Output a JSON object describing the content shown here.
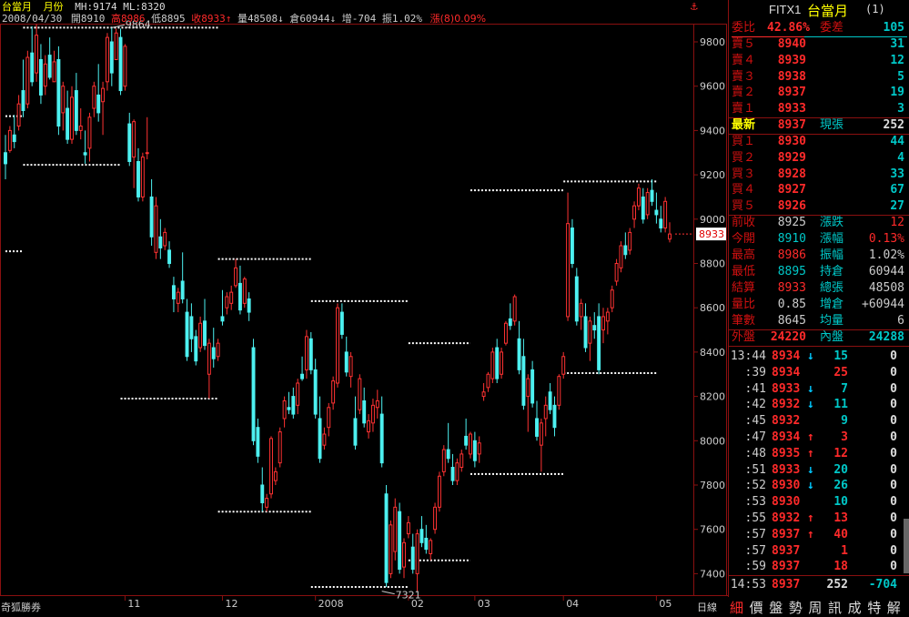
{
  "header": {
    "name": "台當月",
    "period": "月份",
    "ma": "MH:9174 ML:8320",
    "date": "2008/04/30",
    "open_lbl": "開",
    "open": "8910",
    "high_lbl": "高",
    "high": "8986",
    "low_lbl": "低",
    "low": "8895",
    "close_lbl": "收",
    "close": "8933",
    "vol_lbl": "量",
    "vol": "48508",
    "oi_lbl": "倉",
    "oi": "60944",
    "inc_lbl": "增",
    "inc": "-704",
    "amp_lbl": "振",
    "amp": "1.02%",
    "chg": "漲(8)0.09%"
  },
  "bottom": {
    "broker": "奇狐勝券",
    "line_mode": "日線"
  },
  "panel": {
    "symbol": "FITX1",
    "name": "台當月",
    "index": "(1)",
    "ratio_lbl": "委比",
    "ratio": "42.86%",
    "diff_lbl": "委差",
    "diff": "105",
    "asks": [
      {
        "label": "賣５",
        "price": "8940",
        "qty": "31"
      },
      {
        "label": "賣４",
        "price": "8939",
        "qty": "12"
      },
      {
        "label": "賣３",
        "price": "8938",
        "qty": "5"
      },
      {
        "label": "賣２",
        "price": "8937",
        "qty": "19"
      },
      {
        "label": "賣１",
        "price": "8933",
        "qty": "3"
      }
    ],
    "last_lbl": "最新",
    "last": "8937",
    "now_lbl": "現張",
    "now": "252",
    "bids": [
      {
        "label": "買１",
        "price": "8930",
        "qty": "44"
      },
      {
        "label": "買２",
        "price": "8929",
        "qty": "4"
      },
      {
        "label": "買３",
        "price": "8928",
        "qty": "33"
      },
      {
        "label": "買４",
        "price": "8927",
        "qty": "67"
      },
      {
        "label": "買５",
        "price": "8926",
        "qty": "27"
      }
    ],
    "stats": [
      {
        "l1": "前收",
        "v1": "8925",
        "l2": "漲跌",
        "v2": "12",
        "c1": "#cccccc",
        "c2": "#ff2a2a"
      },
      {
        "l1": "今開",
        "v1": "8910",
        "l2": "漲幅",
        "v2": "0.13%",
        "c1": "#00c8c8",
        "c2": "#ff2a2a"
      },
      {
        "l1": "最高",
        "v1": "8986",
        "l2": "振幅",
        "v2": "1.02%",
        "c1": "#ff2a2a",
        "c2": "#cccccc"
      },
      {
        "l1": "最低",
        "v1": "8895",
        "l2": "持倉",
        "v2": "60944",
        "c1": "#00c8c8",
        "c2": "#cccccc"
      },
      {
        "l1": "結算",
        "v1": "8933",
        "l2": "總張",
        "v2": "48508",
        "c1": "#ff2a2a",
        "c2": "#cccccc"
      },
      {
        "l1": "量比",
        "v1": "0.85",
        "l2": "增倉",
        "v2": "+60944",
        "c1": "#cccccc",
        "c2": "#cccccc"
      },
      {
        "l1": "筆數",
        "v1": "8645",
        "l2": "均量",
        "v2": "6",
        "c1": "#cccccc",
        "c2": "#cccccc"
      }
    ],
    "outer_lbl": "外盤",
    "outer": "24220",
    "inner_lbl": "內盤",
    "inner": "24288",
    "ticks": [
      {
        "t": "13:44",
        "p": "8934",
        "a": "↓",
        "v": "15",
        "c": "0",
        "vc": "cy"
      },
      {
        "t": ":39",
        "p": "8934",
        "a": "",
        "v": "25",
        "c": "0",
        "vc": "rd"
      },
      {
        "t": ":41",
        "p": "8933",
        "a": "↓",
        "v": "7",
        "c": "0",
        "vc": "cy"
      },
      {
        "t": ":42",
        "p": "8932",
        "a": "↓",
        "v": "11",
        "c": "0",
        "vc": "cy"
      },
      {
        "t": ":45",
        "p": "8932",
        "a": "",
        "v": "9",
        "c": "0",
        "vc": "cy"
      },
      {
        "t": ":47",
        "p": "8934",
        "a": "↑",
        "v": "3",
        "c": "0",
        "vc": "rd"
      },
      {
        "t": ":48",
        "p": "8935",
        "a": "↑",
        "v": "12",
        "c": "0",
        "vc": "rd"
      },
      {
        "t": ":51",
        "p": "8933",
        "a": "↓",
        "v": "20",
        "c": "0",
        "vc": "cy"
      },
      {
        "t": ":52",
        "p": "8930",
        "a": "↓",
        "v": "26",
        "c": "0",
        "vc": "cy"
      },
      {
        "t": ":53",
        "p": "8930",
        "a": "",
        "v": "10",
        "c": "0",
        "vc": "cy"
      },
      {
        "t": ":55",
        "p": "8932",
        "a": "↑",
        "v": "13",
        "c": "0",
        "vc": "rd"
      },
      {
        "t": ":57",
        "p": "8937",
        "a": "↑",
        "v": "40",
        "c": "0",
        "vc": "rd"
      },
      {
        "t": ":57",
        "p": "8937",
        "a": "",
        "v": "1",
        "c": "0",
        "vc": "rd"
      },
      {
        "t": ":59",
        "p": "8937",
        "a": "",
        "v": "18",
        "c": "0",
        "vc": "rd"
      }
    ],
    "last_tick": {
      "t": "14:53",
      "p": "8937",
      "v": "252",
      "c": "-704"
    },
    "menu": [
      "細",
      "價",
      "盤",
      "勢",
      "周",
      "訊",
      "成",
      "特",
      "解"
    ]
  },
  "chart_data": {
    "type": "candlestick",
    "ylim": [
      7300,
      9940
    ],
    "y_ticks": [
      7400,
      7600,
      7800,
      8000,
      8200,
      8400,
      8600,
      8800,
      9000,
      9200,
      9400,
      9600,
      9800
    ],
    "x_labels": [
      {
        "label": "11",
        "index": 27
      },
      {
        "label": "12",
        "index": 49
      },
      {
        "label": "2008",
        "index": 70
      },
      {
        "label": "02",
        "index": 91
      },
      {
        "label": "03",
        "index": 106
      },
      {
        "label": "04",
        "index": 126
      },
      {
        "label": "05",
        "index": 147
      }
    ],
    "current_price": 8933,
    "annotations": [
      {
        "text": "9864",
        "index": 24,
        "value": 9864
      },
      {
        "text": "7321",
        "index": 85,
        "value": 7321
      }
    ],
    "levels": [
      {
        "value": 9864,
        "from": 4,
        "to": 48
      },
      {
        "value": 9465,
        "from": 0,
        "to": 4
      },
      {
        "value": 9245,
        "from": 4,
        "to": 26
      },
      {
        "value": 8855,
        "from": 0,
        "to": 4
      },
      {
        "value": 8820,
        "from": 48,
        "to": 69
      },
      {
        "value": 8630,
        "from": 69,
        "to": 91
      },
      {
        "value": 8440,
        "from": 91,
        "to": 105
      },
      {
        "value": 8190,
        "from": 26,
        "to": 48
      },
      {
        "value": 8305,
        "from": 126,
        "to": 147
      },
      {
        "value": 9130,
        "from": 105,
        "to": 126
      },
      {
        "value": 9170,
        "from": 126,
        "to": 147
      },
      {
        "value": 7850,
        "from": 105,
        "to": 126
      },
      {
        "value": 7680,
        "from": 48,
        "to": 69
      },
      {
        "value": 7460,
        "from": 91,
        "to": 105
      },
      {
        "value": 7340,
        "from": 69,
        "to": 91
      }
    ],
    "candles": [
      [
        9300,
        9380,
        9180,
        9250
      ],
      [
        9310,
        9420,
        9300,
        9400
      ],
      [
        9380,
        9470,
        9320,
        9350
      ],
      [
        9420,
        9560,
        9400,
        9520
      ],
      [
        9580,
        9720,
        9460,
        9490
      ],
      [
        9520,
        9760,
        9500,
        9730
      ],
      [
        9750,
        9870,
        9600,
        9620
      ],
      [
        9660,
        9880,
        9620,
        9830
      ],
      [
        9720,
        9790,
        9520,
        9560
      ],
      [
        9600,
        9740,
        9560,
        9700
      ],
      [
        9740,
        9820,
        9630,
        9640
      ],
      [
        9620,
        9760,
        9620,
        9710
      ],
      [
        9720,
        9780,
        9380,
        9420
      ],
      [
        9480,
        9620,
        9400,
        9600
      ],
      [
        9500,
        9580,
        9340,
        9360
      ],
      [
        9360,
        9600,
        9340,
        9550
      ],
      [
        9580,
        9660,
        9380,
        9400
      ],
      [
        9400,
        9500,
        9360,
        9420
      ],
      [
        9300,
        9400,
        9250,
        9290
      ],
      [
        9320,
        9480,
        9260,
        9460
      ],
      [
        9500,
        9620,
        9460,
        9600
      ],
      [
        9560,
        9700,
        9440,
        9480
      ],
      [
        9530,
        9620,
        9380,
        9590
      ],
      [
        9620,
        9840,
        9580,
        9820
      ],
      [
        9800,
        9864,
        9600,
        9660
      ],
      [
        9720,
        9860,
        9760,
        9840
      ],
      [
        9820,
        9860,
        9560,
        9580
      ],
      [
        9600,
        9790,
        9580,
        9780
      ],
      [
        9430,
        9480,
        9240,
        9260
      ],
      [
        9280,
        9450,
        9140,
        9440
      ],
      [
        9260,
        9320,
        9080,
        9100
      ],
      [
        9100,
        9300,
        9080,
        9280
      ],
      [
        9300,
        9460,
        9270,
        9300
      ],
      [
        9100,
        9180,
        8880,
        8920
      ],
      [
        8850,
        9100,
        8820,
        9060
      ],
      [
        8920,
        9000,
        8820,
        8870
      ],
      [
        8880,
        8960,
        8860,
        8940
      ],
      [
        8860,
        8900,
        8780,
        8800
      ],
      [
        8700,
        8740,
        8580,
        8640
      ],
      [
        8620,
        8690,
        8580,
        8670
      ],
      [
        8720,
        8850,
        8620,
        8640
      ],
      [
        8580,
        8640,
        8360,
        8380
      ],
      [
        8560,
        8620,
        8400,
        8460
      ],
      [
        8470,
        8500,
        8340,
        8360
      ],
      [
        8420,
        8560,
        8400,
        8530
      ],
      [
        8540,
        8640,
        8410,
        8430
      ],
      [
        8300,
        8460,
        8190,
        8440
      ],
      [
        8420,
        8510,
        8330,
        8370
      ],
      [
        8380,
        8460,
        8360,
        8440
      ],
      [
        8560,
        8680,
        8520,
        8540
      ],
      [
        8600,
        8670,
        8570,
        8650
      ],
      [
        8620,
        8700,
        8590,
        8670
      ],
      [
        8700,
        8820,
        8690,
        8780
      ],
      [
        8710,
        8790,
        8570,
        8590
      ],
      [
        8620,
        8740,
        8600,
        8730
      ],
      [
        8640,
        8670,
        8540,
        8580
      ],
      [
        8420,
        8460,
        7980,
        8000
      ],
      [
        8060,
        8100,
        7900,
        7930
      ],
      [
        7800,
        7880,
        7680,
        7720
      ],
      [
        7700,
        7760,
        7680,
        7740
      ],
      [
        7760,
        8020,
        7740,
        8010
      ],
      [
        7820,
        7880,
        7800,
        7860
      ],
      [
        7900,
        8060,
        7880,
        8040
      ],
      [
        8100,
        8200,
        8060,
        8180
      ],
      [
        8150,
        8220,
        8120,
        8140
      ],
      [
        8200,
        8240,
        8100,
        8120
      ],
      [
        8160,
        8280,
        8120,
        8260
      ],
      [
        8300,
        8380,
        8270,
        8280
      ],
      [
        8320,
        8500,
        8280,
        8470
      ],
      [
        8460,
        8490,
        8300,
        8320
      ],
      [
        8320,
        8370,
        8100,
        8120
      ],
      [
        8100,
        8200,
        7900,
        7920
      ],
      [
        7980,
        8060,
        7960,
        8030
      ],
      [
        8060,
        8170,
        8020,
        8150
      ],
      [
        8170,
        8290,
        8140,
        8270
      ],
      [
        8260,
        8620,
        8240,
        8600
      ],
      [
        8580,
        8620,
        8460,
        8480
      ],
      [
        8400,
        8470,
        8290,
        8310
      ],
      [
        8290,
        8400,
        8240,
        8380
      ],
      [
        8100,
        8200,
        7960,
        7980
      ],
      [
        8140,
        8300,
        8120,
        8280
      ],
      [
        8180,
        8240,
        8060,
        8080
      ],
      [
        8040,
        8120,
        8010,
        8090
      ],
      [
        8080,
        8190,
        8040,
        8160
      ],
      [
        8150,
        8230,
        8100,
        8180
      ],
      [
        8120,
        8200,
        7880,
        7900
      ],
      [
        7760,
        7800,
        7340,
        7360
      ],
      [
        7400,
        7640,
        7380,
        7620
      ],
      [
        7500,
        7740,
        7460,
        7700
      ],
      [
        7680,
        7720,
        7400,
        7420
      ],
      [
        7430,
        7560,
        7380,
        7540
      ],
      [
        7580,
        7660,
        7560,
        7630
      ],
      [
        7520,
        7580,
        7400,
        7420
      ],
      [
        7400,
        7600,
        7321,
        7580
      ],
      [
        7600,
        7660,
        7520,
        7540
      ],
      [
        7560,
        7620,
        7490,
        7510
      ],
      [
        7490,
        7560,
        7460,
        7550
      ],
      [
        7600,
        7720,
        7580,
        7700
      ],
      [
        7700,
        7860,
        7680,
        7840
      ],
      [
        7860,
        7980,
        7840,
        7960
      ],
      [
        7960,
        8080,
        7900,
        7920
      ],
      [
        7880,
        7940,
        7800,
        7820
      ],
      [
        7820,
        7920,
        7800,
        7900
      ],
      [
        7880,
        7960,
        7860,
        7940
      ],
      [
        8020,
        8100,
        7960,
        7980
      ],
      [
        7940,
        8040,
        7920,
        8030
      ],
      [
        8000,
        8040,
        7880,
        7910
      ],
      [
        7940,
        8020,
        7900,
        7990
      ],
      [
        8200,
        8260,
        8180,
        8220
      ],
      [
        8240,
        8310,
        8220,
        8300
      ],
      [
        8280,
        8420,
        8260,
        8400
      ],
      [
        8420,
        8460,
        8260,
        8280
      ],
      [
        8300,
        8420,
        8280,
        8400
      ],
      [
        8440,
        8540,
        8430,
        8530
      ],
      [
        8550,
        8620,
        8500,
        8520
      ],
      [
        8540,
        8660,
        8520,
        8650
      ],
      [
        8460,
        8540,
        8300,
        8320
      ],
      [
        8380,
        8460,
        8140,
        8160
      ],
      [
        8200,
        8300,
        8040,
        8280
      ],
      [
        8320,
        8360,
        8150,
        8170
      ],
      [
        8100,
        8180,
        8000,
        8020
      ],
      [
        7980,
        8100,
        7860,
        8080
      ],
      [
        8100,
        8200,
        8020,
        8160
      ],
      [
        8220,
        8260,
        8120,
        8140
      ],
      [
        8160,
        8200,
        8020,
        8060
      ],
      [
        8160,
        8300,
        8140,
        8290
      ],
      [
        8300,
        8400,
        8280,
        8380
      ],
      [
        8560,
        9120,
        8540,
        8980
      ],
      [
        8960,
        9000,
        8780,
        8800
      ],
      [
        8740,
        8780,
        8520,
        8540
      ],
      [
        8560,
        8640,
        8500,
        8620
      ],
      [
        8560,
        8620,
        8400,
        8420
      ],
      [
        8440,
        8560,
        8360,
        8540
      ],
      [
        8520,
        8580,
        8460,
        8500
      ],
      [
        8560,
        8620,
        8300,
        8320
      ],
      [
        8500,
        8600,
        8440,
        8560
      ],
      [
        8540,
        8600,
        8480,
        8580
      ],
      [
        8600,
        8700,
        8580,
        8680
      ],
      [
        8720,
        8820,
        8700,
        8800
      ],
      [
        8780,
        8900,
        8760,
        8880
      ],
      [
        8880,
        8940,
        8820,
        8840
      ],
      [
        8860,
        8960,
        8840,
        8940
      ],
      [
        9000,
        9080,
        8960,
        9060
      ],
      [
        9060,
        9160,
        9040,
        9140
      ],
      [
        9100,
        9140,
        8980,
        9000
      ],
      [
        9020,
        9140,
        9000,
        9120
      ],
      [
        9130,
        9180,
        9060,
        9080
      ],
      [
        9040,
        9120,
        8980,
        9020
      ],
      [
        9000,
        9060,
        8940,
        8960
      ],
      [
        8960,
        9100,
        8940,
        9080
      ],
      [
        8910,
        8986,
        8895,
        8933
      ]
    ]
  }
}
